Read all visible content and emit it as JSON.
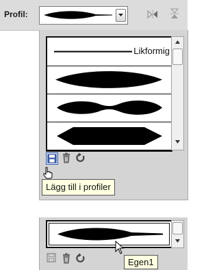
{
  "profile_bar": {
    "label": "Profil:"
  },
  "profile_list": {
    "items": [
      {
        "name": "Likformig",
        "shape": "uniform-line"
      },
      {
        "name": "",
        "shape": "lens"
      },
      {
        "name": "",
        "shape": "double-bulb"
      },
      {
        "name": "",
        "shape": "hexagon"
      }
    ]
  },
  "toolbar": {
    "add_tooltip": "Lägg till i profiler"
  },
  "custom_profile": {
    "tooltip": "Egen1"
  },
  "colors": {
    "panel": "#d4d4d4",
    "tooltip_bg": "#ffffe1",
    "shape": "#000000"
  }
}
